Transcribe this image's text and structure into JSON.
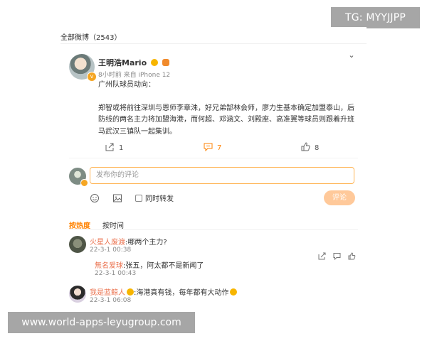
{
  "watermarks": {
    "top_right": "TG: MYYJJPP",
    "bottom_left": "www.world-apps-leyugroup.com"
  },
  "section": {
    "title": "全部微博（2543）"
  },
  "post": {
    "author": "王明浩Mario",
    "time": "8小时前",
    "source": "来自 iPhone 12",
    "title_line": "广州队球员动向：",
    "body": "郑智或将前往深圳与恩师李章洙，好兄弟郜林会师，廖力生基本确定加盟泰山，后防线的两名主力将加盟海港，而何超、邓涵文、刘殿座、高准翼等球员则跟着升班马武汉三镇队一起集训。",
    "actions": {
      "forward_count": "1",
      "comment_count": "7",
      "like_count": "8"
    }
  },
  "composer": {
    "placeholder": "发布你的评论",
    "forward_label": "同时转发",
    "submit_label": "评论"
  },
  "sort": {
    "hot": "按热度",
    "time": "按时间"
  },
  "comments": [
    {
      "user": "火星人废渡",
      "text": ":哪两个主力?",
      "time": "22-3-1 00:38",
      "reply": {
        "user": "無名爱球",
        "text": ":张五，阿太都不是新闻了",
        "time": "22-3-1 00:43"
      }
    },
    {
      "user": "我是蓝鲸人",
      "text": ":海港真有钱，每年都有大动作",
      "time": "22-3-1 06:08"
    }
  ],
  "colors": {
    "accent": "#ff8200",
    "username": "#eb7350",
    "input_border": "#ffb454",
    "submit_bg": "#ffc99a"
  }
}
